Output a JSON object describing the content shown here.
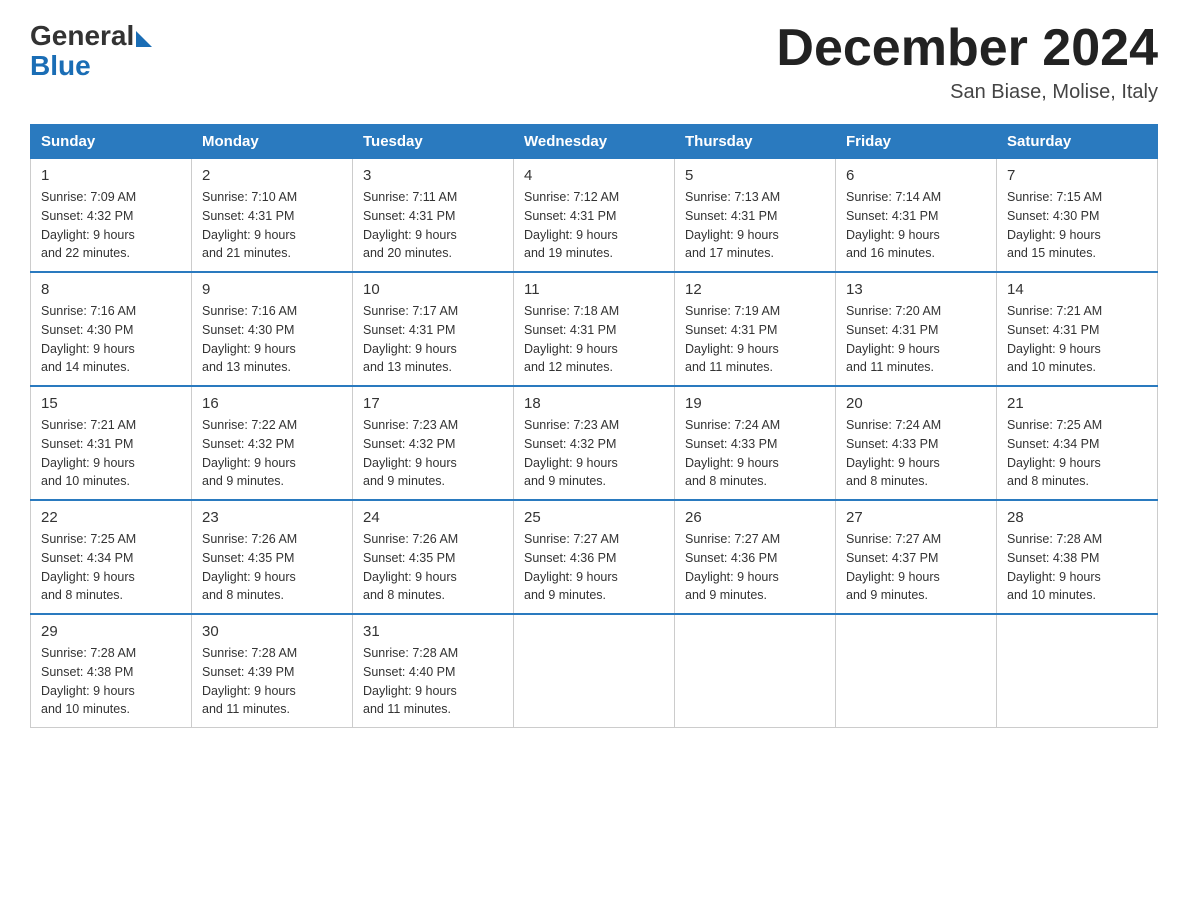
{
  "logo": {
    "general": "General",
    "blue": "Blue"
  },
  "title": "December 2024",
  "subtitle": "San Biase, Molise, Italy",
  "headers": [
    "Sunday",
    "Monday",
    "Tuesday",
    "Wednesday",
    "Thursday",
    "Friday",
    "Saturday"
  ],
  "weeks": [
    [
      {
        "day": "1",
        "sunrise": "7:09 AM",
        "sunset": "4:32 PM",
        "daylight": "9 hours and 22 minutes."
      },
      {
        "day": "2",
        "sunrise": "7:10 AM",
        "sunset": "4:31 PM",
        "daylight": "9 hours and 21 minutes."
      },
      {
        "day": "3",
        "sunrise": "7:11 AM",
        "sunset": "4:31 PM",
        "daylight": "9 hours and 20 minutes."
      },
      {
        "day": "4",
        "sunrise": "7:12 AM",
        "sunset": "4:31 PM",
        "daylight": "9 hours and 19 minutes."
      },
      {
        "day": "5",
        "sunrise": "7:13 AM",
        "sunset": "4:31 PM",
        "daylight": "9 hours and 17 minutes."
      },
      {
        "day": "6",
        "sunrise": "7:14 AM",
        "sunset": "4:31 PM",
        "daylight": "9 hours and 16 minutes."
      },
      {
        "day": "7",
        "sunrise": "7:15 AM",
        "sunset": "4:30 PM",
        "daylight": "9 hours and 15 minutes."
      }
    ],
    [
      {
        "day": "8",
        "sunrise": "7:16 AM",
        "sunset": "4:30 PM",
        "daylight": "9 hours and 14 minutes."
      },
      {
        "day": "9",
        "sunrise": "7:16 AM",
        "sunset": "4:30 PM",
        "daylight": "9 hours and 13 minutes."
      },
      {
        "day": "10",
        "sunrise": "7:17 AM",
        "sunset": "4:31 PM",
        "daylight": "9 hours and 13 minutes."
      },
      {
        "day": "11",
        "sunrise": "7:18 AM",
        "sunset": "4:31 PM",
        "daylight": "9 hours and 12 minutes."
      },
      {
        "day": "12",
        "sunrise": "7:19 AM",
        "sunset": "4:31 PM",
        "daylight": "9 hours and 11 minutes."
      },
      {
        "day": "13",
        "sunrise": "7:20 AM",
        "sunset": "4:31 PM",
        "daylight": "9 hours and 11 minutes."
      },
      {
        "day": "14",
        "sunrise": "7:21 AM",
        "sunset": "4:31 PM",
        "daylight": "9 hours and 10 minutes."
      }
    ],
    [
      {
        "day": "15",
        "sunrise": "7:21 AM",
        "sunset": "4:31 PM",
        "daylight": "9 hours and 10 minutes."
      },
      {
        "day": "16",
        "sunrise": "7:22 AM",
        "sunset": "4:32 PM",
        "daylight": "9 hours and 9 minutes."
      },
      {
        "day": "17",
        "sunrise": "7:23 AM",
        "sunset": "4:32 PM",
        "daylight": "9 hours and 9 minutes."
      },
      {
        "day": "18",
        "sunrise": "7:23 AM",
        "sunset": "4:32 PM",
        "daylight": "9 hours and 9 minutes."
      },
      {
        "day": "19",
        "sunrise": "7:24 AM",
        "sunset": "4:33 PM",
        "daylight": "9 hours and 8 minutes."
      },
      {
        "day": "20",
        "sunrise": "7:24 AM",
        "sunset": "4:33 PM",
        "daylight": "9 hours and 8 minutes."
      },
      {
        "day": "21",
        "sunrise": "7:25 AM",
        "sunset": "4:34 PM",
        "daylight": "9 hours and 8 minutes."
      }
    ],
    [
      {
        "day": "22",
        "sunrise": "7:25 AM",
        "sunset": "4:34 PM",
        "daylight": "9 hours and 8 minutes."
      },
      {
        "day": "23",
        "sunrise": "7:26 AM",
        "sunset": "4:35 PM",
        "daylight": "9 hours and 8 minutes."
      },
      {
        "day": "24",
        "sunrise": "7:26 AM",
        "sunset": "4:35 PM",
        "daylight": "9 hours and 8 minutes."
      },
      {
        "day": "25",
        "sunrise": "7:27 AM",
        "sunset": "4:36 PM",
        "daylight": "9 hours and 9 minutes."
      },
      {
        "day": "26",
        "sunrise": "7:27 AM",
        "sunset": "4:36 PM",
        "daylight": "9 hours and 9 minutes."
      },
      {
        "day": "27",
        "sunrise": "7:27 AM",
        "sunset": "4:37 PM",
        "daylight": "9 hours and 9 minutes."
      },
      {
        "day": "28",
        "sunrise": "7:28 AM",
        "sunset": "4:38 PM",
        "daylight": "9 hours and 10 minutes."
      }
    ],
    [
      {
        "day": "29",
        "sunrise": "7:28 AM",
        "sunset": "4:38 PM",
        "daylight": "9 hours and 10 minutes."
      },
      {
        "day": "30",
        "sunrise": "7:28 AM",
        "sunset": "4:39 PM",
        "daylight": "9 hours and 11 minutes."
      },
      {
        "day": "31",
        "sunrise": "7:28 AM",
        "sunset": "4:40 PM",
        "daylight": "9 hours and 11 minutes."
      },
      null,
      null,
      null,
      null
    ]
  ]
}
